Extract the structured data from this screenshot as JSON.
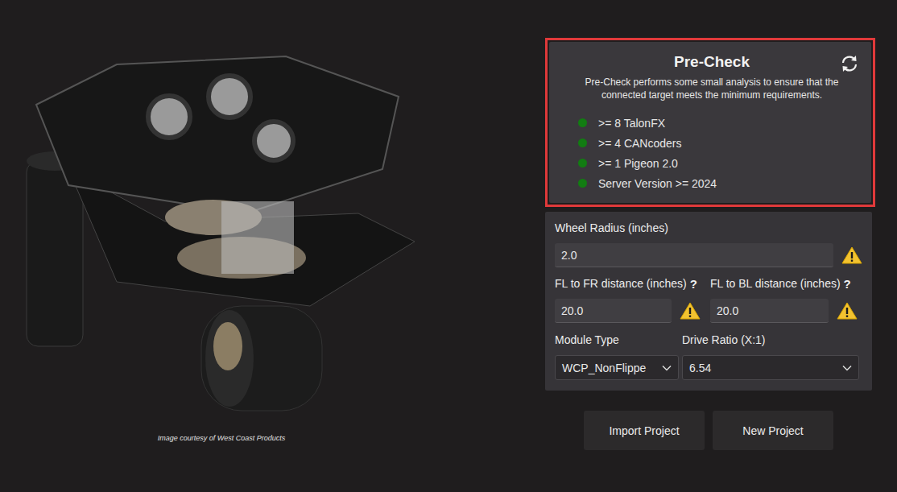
{
  "image": {
    "caption": "Image courtesy of West Coast Products"
  },
  "precheck": {
    "title": "Pre-Check",
    "description": "Pre-Check performs some small analysis to ensure that the connected target meets the minimum requirements.",
    "highlighted": true,
    "items": [
      {
        "label": ">= 8 TalonFX",
        "color": "#127c12"
      },
      {
        "label": ">= 4 CANcoders",
        "color": "#127c12"
      },
      {
        "label": ">= 1 Pigeon 2.0",
        "color": "#127c12"
      },
      {
        "label": "Server Version >= 2024",
        "color": "#127c12"
      }
    ]
  },
  "form": {
    "wheel_radius": {
      "label": "Wheel Radius (inches)",
      "value": "2.0",
      "warning": true
    },
    "fl_to_fr": {
      "label": "FL to FR distance (inches)",
      "help": "?",
      "value": "20.0",
      "warning": true
    },
    "fl_to_bl": {
      "label": "FL to BL distance (inches)",
      "help": "?",
      "value": "20.0",
      "warning": true
    },
    "module_type": {
      "label": "Module Type",
      "value": "WCP_NonFlippe"
    },
    "drive_ratio": {
      "label": "Drive Ratio (X:1)",
      "value": "6.54"
    }
  },
  "buttons": [
    "Import Project",
    "New Project"
  ]
}
